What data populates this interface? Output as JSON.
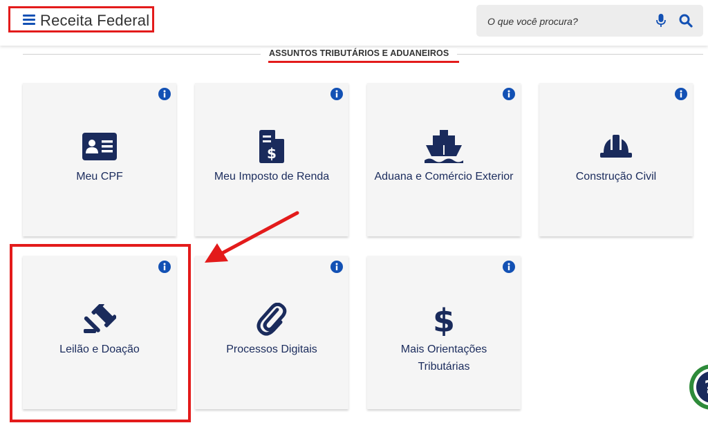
{
  "header": {
    "brand": "Receita Federal",
    "search_placeholder": "O que você procura?"
  },
  "section": {
    "title": "ASSUNTOS TRIBUTÁRIOS E ADUANEIROS"
  },
  "cards": [
    {
      "label": "Meu CPF",
      "icon": "id-card-icon"
    },
    {
      "label": "Meu Imposto de Renda",
      "icon": "tax-document-icon"
    },
    {
      "label": "Aduana e Comércio Exterior",
      "icon": "ship-icon"
    },
    {
      "label": "Construção Civil",
      "icon": "hard-hat-icon"
    },
    {
      "label": "Leilão e Doação",
      "icon": "gavel-icon"
    },
    {
      "label": "Processos Digitais",
      "icon": "paperclip-icon"
    },
    {
      "label": "Mais Orientações Tributárias",
      "icon": "dollar-sign-icon"
    }
  ],
  "colors": {
    "accent_blue": "#1351b4",
    "icon_navy": "#1a2b5c",
    "annotation_red": "#e31b1b",
    "badge_green": "#2e8b3a"
  }
}
